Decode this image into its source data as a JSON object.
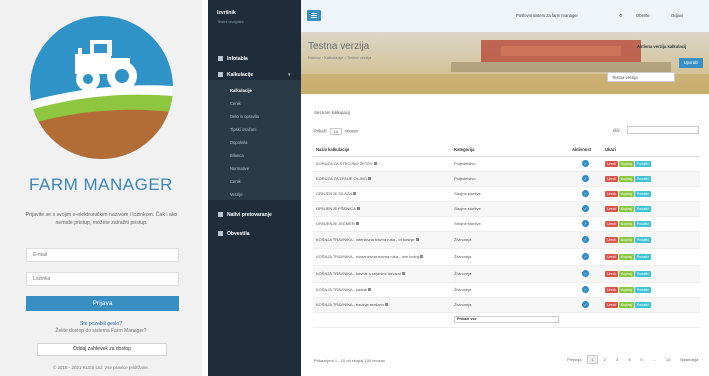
{
  "login": {
    "brand": "FARM MANAGER",
    "message": "Prijavite se s svojim e-elektroničkim nazivom i lozinkom. Čak i ako nemate pristup, možete zatražiti pristup.",
    "email_placeholder": "E-mail",
    "password_placeholder": "Lozinka",
    "login_button": "Prijava",
    "forgot_link": "Ste pozabili geslo?",
    "access_message": "Želite dostop do sistema Farm Manager?",
    "access_button": "Oddaj zahtevek za dostop",
    "copyright": "© 2015 - 2021 KLES Ltd. Vse pravice pridržane."
  },
  "sidebar": {
    "user": "Izvršnik",
    "user_info": "Testni izvajalec",
    "sections": [
      {
        "label": "Infotabla"
      },
      {
        "label": "Kalkulacije"
      },
      {
        "label": "Nalivi pretovaranje"
      },
      {
        "label": "Obvestila"
      }
    ],
    "items": [
      "Kalkulacije",
      "Cenik",
      "Delo in opravila",
      "Tipski izračuni",
      "Dopolnila",
      "Bilanca",
      "Normative",
      "Cenik",
      "Verzije"
    ]
  },
  "topbar": {
    "org": "Poslovni sistem za farm manager",
    "user": "Izberite",
    "logout": "Odjavi"
  },
  "banner": {
    "title": "Testna verzija",
    "breadcrumb": "Domov  ›  Kalkulacije  ›  Testna verzija",
    "right_label": "Aktivna verzija kalkulacij",
    "select_value": "Testna verzija",
    "button": "Uporabi"
  },
  "table": {
    "panel_title": "Seznam kalkulacij",
    "show_prefix": "Prikaži",
    "show_value": "10",
    "show_suffix": "vnosov",
    "search_label": "Išči:",
    "headers": [
      "Naziv kalkulacije",
      "Kategorija",
      "Aktivnost",
      "Ukazi"
    ],
    "rows": [
      {
        "name": "KORUZA ZA STROJNO ŽETEV",
        "category": "Poljedelstvo"
      },
      {
        "name": "KORUZA ZA ZRNJE OLJNO",
        "category": "Poljedelstvo"
      },
      {
        "name": "ORNJENJE SILAŽA",
        "category": "Strojne storitve"
      },
      {
        "name": "ORNJENJE PŠENICA",
        "category": "Strojne storitve"
      },
      {
        "name": "ORNJENJE JEČMEN",
        "category": "Strojne storitve"
      },
      {
        "name": "KOŠNJA TRAVNIKA - intenzivna travna ruša - tri košnje",
        "category": "Živinoreja"
      },
      {
        "name": "KOŠNJA TRAVNIKA - ekstenzivna travna ruša - dve košnji",
        "category": "Živinoreja"
      },
      {
        "name": "KOŠNJA TRAVNIKA - travnik s sejanimi travami",
        "category": "Živinoreja"
      },
      {
        "name": "KOŠNJA TRAVNIKA - pašnik",
        "category": "Živinoreja"
      },
      {
        "name": "KOŠNJA TRAVNIKA - travinje mešano",
        "category": "Živinoreja"
      }
    ],
    "row_tall": [
      false,
      false,
      false,
      false,
      false,
      true,
      true,
      true,
      false,
      false
    ],
    "action_labels": [
      "Uredi",
      "Kopiraj",
      "Podatki"
    ],
    "check_glyph": "✓",
    "filter_value": "Prikaži vse",
    "footer_info": "Prikazujem 1 - 10 od skupaj 100 vnosov",
    "pager": [
      "Prejšnja",
      "1",
      "2",
      "3",
      "4",
      "5",
      "...",
      "10",
      "Naslednja"
    ]
  },
  "colors": {
    "accent": "#3a8fc2",
    "sidebar": "#1f2d3a",
    "danger": "#d9534f",
    "success": "#8cc63f",
    "info": "#3ec3d5"
  }
}
